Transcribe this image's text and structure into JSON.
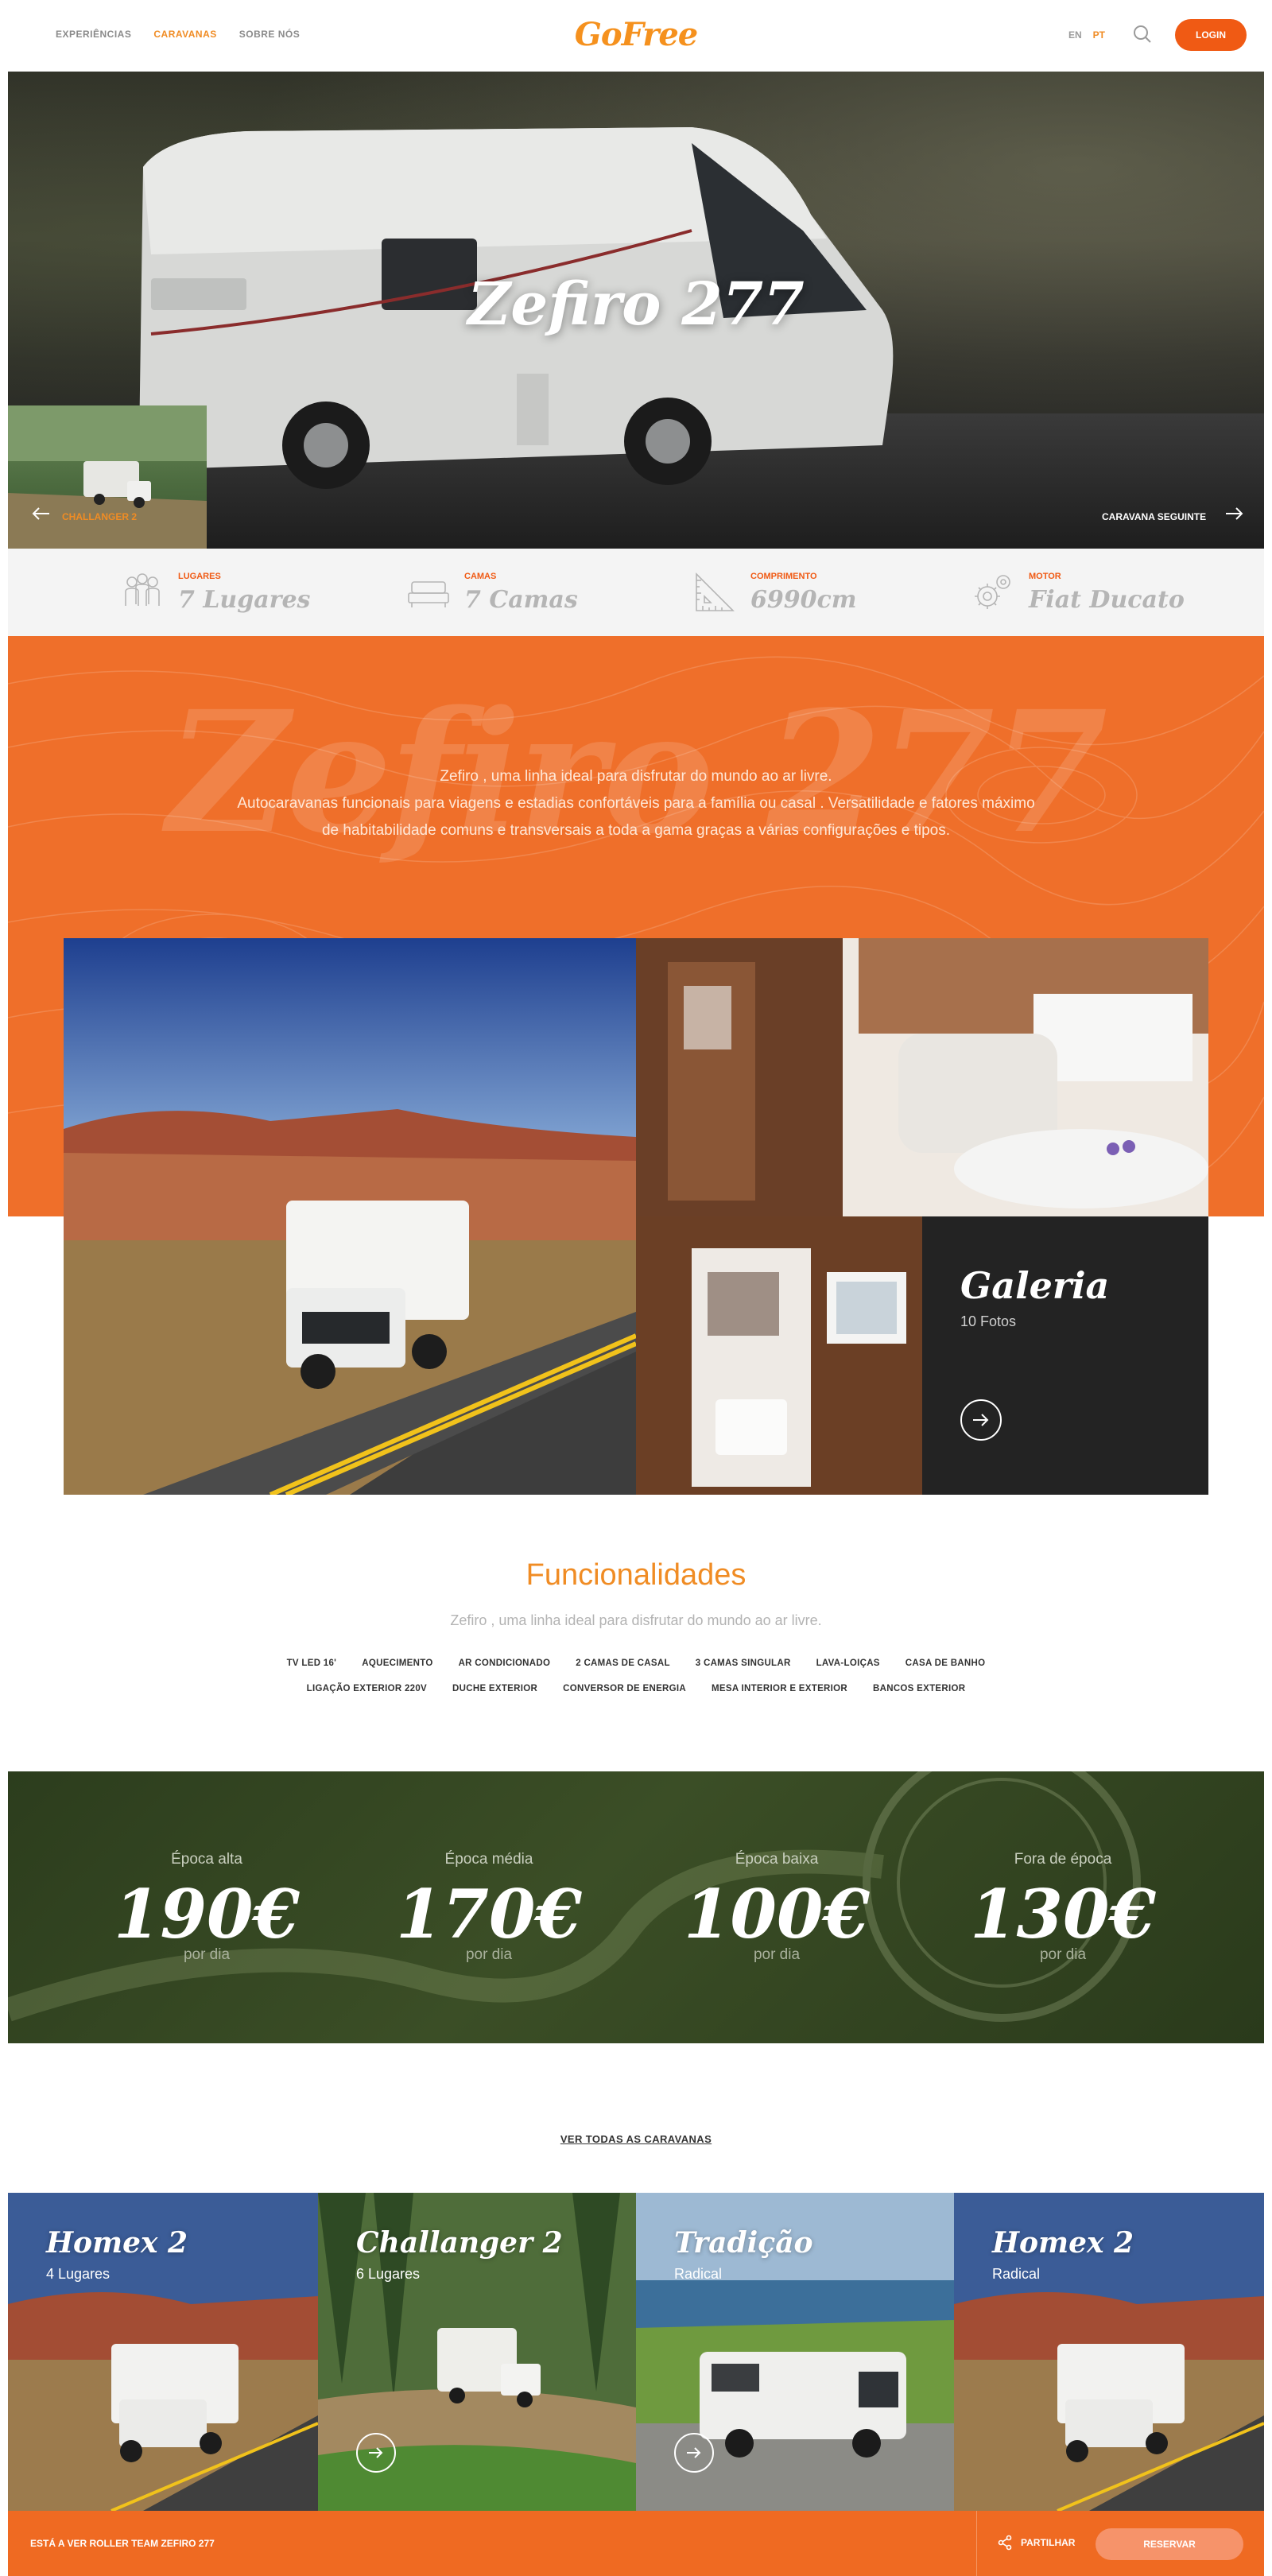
{
  "header": {
    "nav": [
      {
        "label": "EXPERIÊNCIAS",
        "active": false
      },
      {
        "label": "CARAVANAS",
        "active": true
      },
      {
        "label": "SOBRE NÓS",
        "active": false
      }
    ],
    "logo_text": "GoFree",
    "lang_en": "EN",
    "lang_pt": "PT",
    "login_label": "LOGIN"
  },
  "hero": {
    "title": "Zefiro 277",
    "prev_label": "CHALLANGER 2",
    "next_label": "CARAVANA SEGUINTE"
  },
  "specs": [
    {
      "icon": "people-icon",
      "label": "LUGARES",
      "value": "7 Lugares"
    },
    {
      "icon": "bed-icon",
      "label": "CAMAS",
      "value": "7 Camas"
    },
    {
      "icon": "ruler-icon",
      "label": "COMPRIMENTO",
      "value": "6990cm"
    },
    {
      "icon": "gear-icon",
      "label": "MOTOR",
      "value": "Fiat Ducato"
    }
  ],
  "intro": {
    "watermark": "Zefiro 277",
    "line1": "Zefiro , uma linha ideal para disfrutar do mundo ao ar livre.",
    "line2": "Autocaravanas funcionais para viagens e estadias confortáveis para a família ou casal . Versatilidade e fatores máximo",
    "line3": "de habitabilidade comuns e transversais a toda a gama graças a várias configurações e tipos."
  },
  "gallery": {
    "title": "Galeria",
    "count": "10 Fotos"
  },
  "features": {
    "title": "Funcionalidades",
    "subtitle": "Zefiro , uma linha ideal para disfrutar do mundo ao ar livre.",
    "row1": [
      "TV LED 16'",
      "AQUECIMENTO",
      "AR CONDICIONADO",
      "2 CAMAS DE CASAL",
      "3 CAMAS SINGULAR",
      "LAVA-LOIÇAS",
      "CASA DE BANHO"
    ],
    "row2": [
      "LIGAÇÃO EXTERIOR 220V",
      "DUCHE EXTERIOR",
      "CONVERSOR DE ENERGIA",
      "MESA INTERIOR E EXTERIOR",
      "BANCOS EXTERIOR"
    ]
  },
  "prices": [
    {
      "season": "Época alta",
      "amount": "190€",
      "per": "por dia"
    },
    {
      "season": "Época média",
      "amount": "170€",
      "per": "por dia"
    },
    {
      "season": "Época baixa",
      "amount": "100€",
      "per": "por dia"
    },
    {
      "season": "Fora de época",
      "amount": "130€",
      "per": "por dia"
    }
  ],
  "ver_todas": "VER TODAS AS CARAVANAS",
  "cards": [
    {
      "name": "Homex 2",
      "sub": "4 Lugares",
      "scene": "desert"
    },
    {
      "name": "Challanger 2",
      "sub": "6 Lugares",
      "scene": "forest"
    },
    {
      "name": "Tradição",
      "sub": "Radical",
      "scene": "coast"
    },
    {
      "name": "Homex 2",
      "sub": "Radical",
      "scene": "desert"
    }
  ],
  "bottom": {
    "text": "ESTÁ A VER ROLLER TEAM ZEFIRO 277",
    "share": "PARTILHAR",
    "reserve": "RESERVAR"
  },
  "colors": {
    "accent": "#f08c24",
    "orange_band": "#ef6f2a",
    "login": "#f05a14",
    "dark_panel": "#232323",
    "price_green": "#34471f"
  }
}
